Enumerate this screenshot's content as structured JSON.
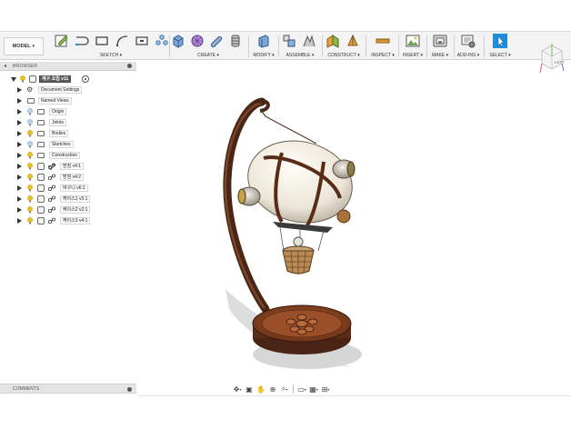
{
  "toolbar": {
    "mode_label": "MODEL",
    "groups": [
      {
        "label": "SKETCH"
      },
      {
        "label": "CREATE"
      },
      {
        "label": "MODIFY"
      },
      {
        "label": "ASSEMBLE"
      },
      {
        "label": "CONSTRUCT"
      },
      {
        "label": "INSPECT"
      },
      {
        "label": "INSERT"
      },
      {
        "label": "MAKE"
      },
      {
        "label": "ADD-INS"
      },
      {
        "label": "SELECT"
      }
    ]
  },
  "viewcube": {
    "face_label": "LEFT"
  },
  "browser": {
    "title": "BROWSER",
    "root": {
      "label": "계구 조립 v11"
    },
    "items": [
      {
        "label": "Document Settings",
        "icon": "gear-icon"
      },
      {
        "label": "Named Views",
        "icon": "folder-icon"
      },
      {
        "label": "Origin",
        "icon": "folder-icon"
      },
      {
        "label": "Joints",
        "icon": "folder-icon"
      },
      {
        "label": "Bodies",
        "icon": "folder-icon"
      },
      {
        "label": "Sketches",
        "icon": "folder-icon"
      },
      {
        "label": "Construction",
        "icon": "folder-icon"
      },
      {
        "label": "받침 v4:1",
        "icon": "link-icon"
      },
      {
        "label": "받침 v4:2",
        "icon": "link-icon"
      },
      {
        "label": "바구니 v6:1",
        "icon": "link-icon"
      },
      {
        "label": "케이스1 v5:1",
        "icon": "link-icon"
      },
      {
        "label": "케이스2 v2:1",
        "icon": "link-icon"
      },
      {
        "label": "케이스3 v4:1",
        "icon": "link-icon"
      }
    ]
  },
  "comments": {
    "title": "COMMENTS"
  },
  "colors": {
    "toolbar_bg": "#f3f3f3",
    "select_blue": "#1e8fd6",
    "wood_dark": "#5b2f1c",
    "wood_mid": "#8a4a2a",
    "balloon_white": "#f1ede4",
    "bulb_yellow": "#f2c21a"
  }
}
